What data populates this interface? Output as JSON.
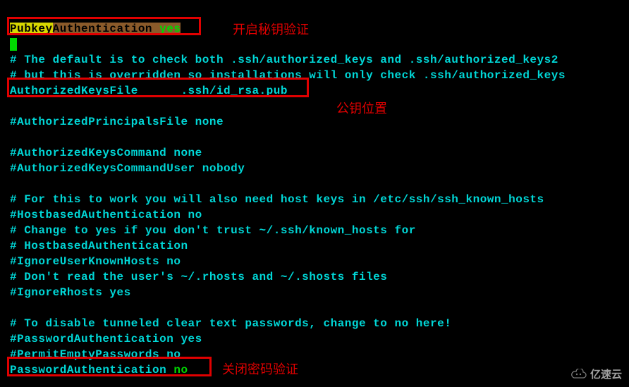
{
  "pubkey_directive": {
    "pubkey": "Pubkey",
    "auth": "Authentication",
    "space": " ",
    "yes": "yes"
  },
  "lines": {
    "l3": "# The default is to check both .ssh/authorized_keys and .ssh/authorized_keys2",
    "l4": "# but this is overridden so installations will only check .ssh/authorized_keys",
    "l5_key": "AuthorizedKeysFile",
    "l5_pad": "      ",
    "l5_val": ".ssh/id_rsa.pub",
    "l7": "#AuthorizedPrincipalsFile none",
    "l9": "#AuthorizedKeysCommand none",
    "l10": "#AuthorizedKeysCommandUser nobody",
    "l12": "# For this to work you will also need host keys in /etc/ssh/ssh_known_hosts",
    "l13": "#HostbasedAuthentication no",
    "l14": "# Change to yes if you don't trust ~/.ssh/known_hosts for",
    "l15": "# HostbasedAuthentication",
    "l16": "#IgnoreUserKnownHosts no",
    "l17": "# Don't read the user's ~/.rhosts and ~/.shosts files",
    "l18": "#IgnoreRhosts yes",
    "l20": "# To disable tunneled clear text passwords, change to no here!",
    "l21": "#PasswordAuthentication yes",
    "l22": "#PermitEmptyPasswords no",
    "l23_key": "PasswordAuthentication ",
    "l23_val": "no"
  },
  "annotations": {
    "a1": "开启秘钥验证",
    "a2": "公钥位置",
    "a3": "关闭密码验证"
  },
  "watermark": "亿速云"
}
